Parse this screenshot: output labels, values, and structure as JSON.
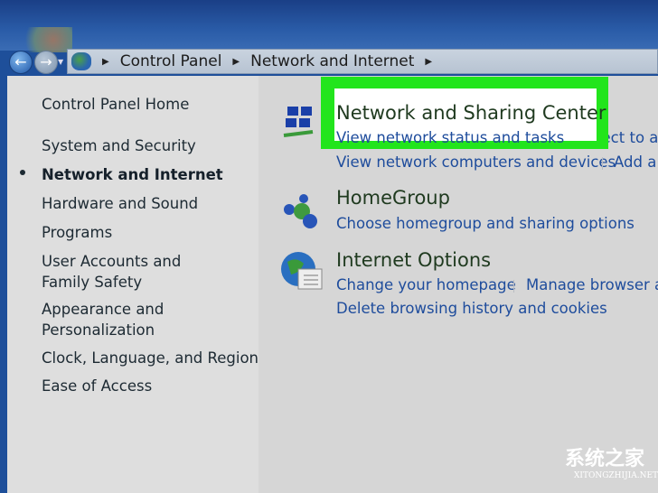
{
  "address_bar": {
    "crumbs": [
      "Control Panel",
      "Network and Internet"
    ]
  },
  "sidebar": {
    "home": "Control Panel Home",
    "items": [
      {
        "label": "System and Security"
      },
      {
        "label": "Network and Internet",
        "active": true
      },
      {
        "label": "Hardware and Sound"
      },
      {
        "label": "Programs"
      },
      {
        "label": "User Accounts and Family Safety"
      },
      {
        "label": "Appearance and Personalization"
      },
      {
        "label": "Clock, Language, and Region"
      },
      {
        "label": "Ease of Access"
      }
    ]
  },
  "sections": [
    {
      "title": "Network and Sharing Center",
      "icon": "network-icon",
      "links": [
        "View network status and tasks",
        "Connect to a n",
        "View network computers and devices",
        "Add a"
      ]
    },
    {
      "title": "HomeGroup",
      "icon": "homegroup-icon",
      "links": [
        "Choose homegroup and sharing options"
      ]
    },
    {
      "title": "Internet Options",
      "icon": "internet-options-icon",
      "links": [
        "Change your homepage",
        "Manage browser ac",
        "Delete browsing history and cookies"
      ]
    }
  ],
  "highlight_color": "#22e51c",
  "watermark": {
    "text": "系统之家",
    "sub": "XITONGZHIJIA.NET"
  }
}
